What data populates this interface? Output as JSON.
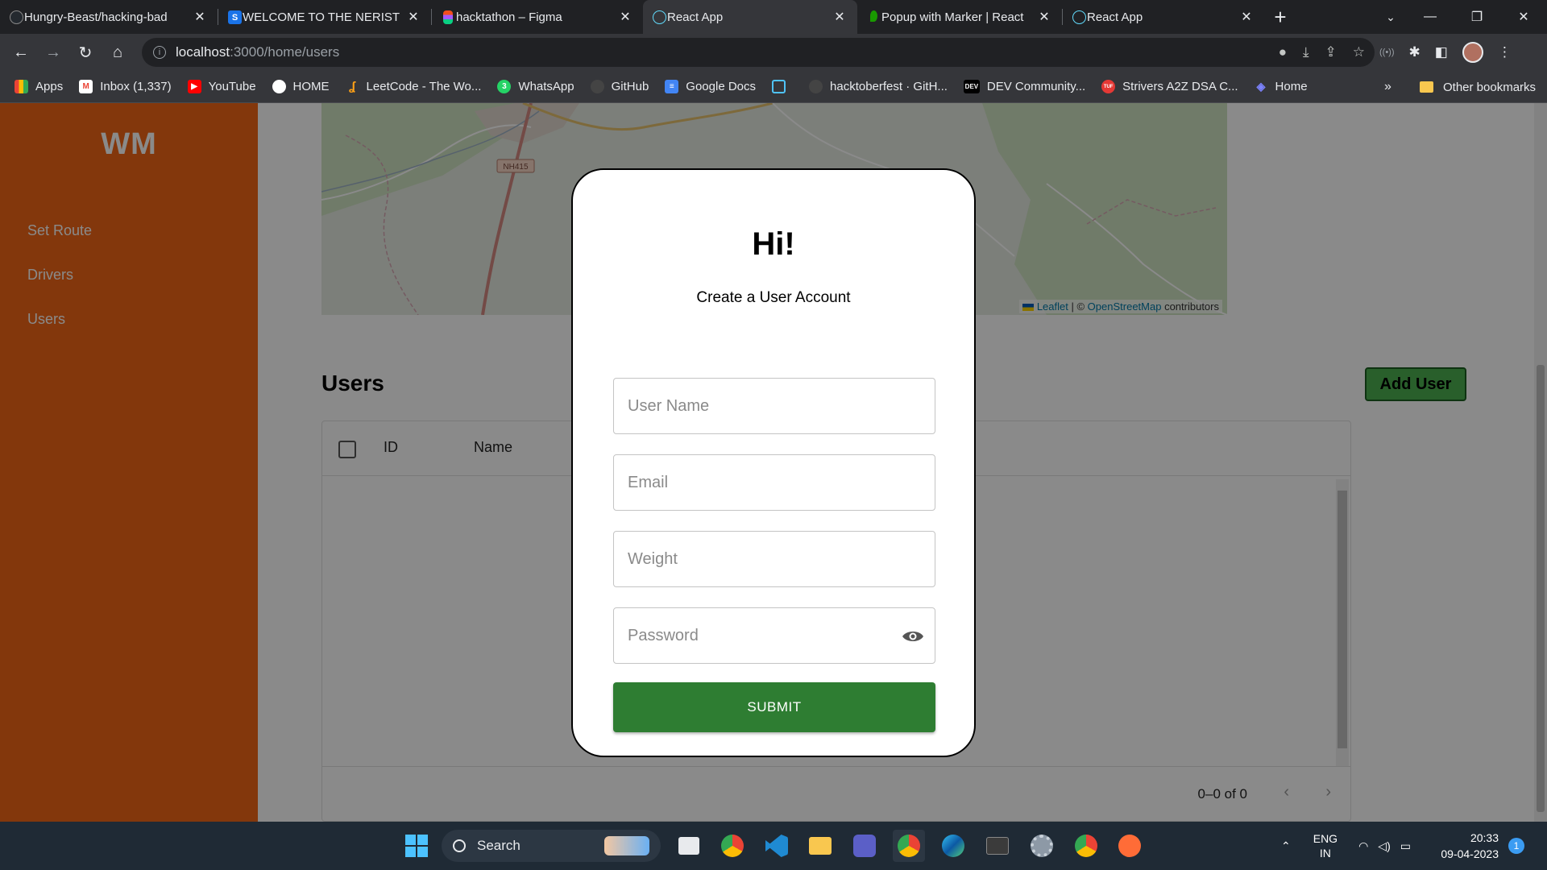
{
  "browser": {
    "tabs": [
      {
        "title": "Hungry-Beast/hacking-bad",
        "icon": "github-icon",
        "color": "#24292f"
      },
      {
        "title": "WELCOME TO THE NERIST",
        "icon": "s-logo-icon",
        "color": "#1a73e8"
      },
      {
        "title": "hacktathon – Figma",
        "icon": "figma-icon",
        "color": "#f24e1e"
      },
      {
        "title": "React App",
        "icon": "react-icon",
        "color": "#61dafb"
      },
      {
        "title": "Popup with Marker | React",
        "icon": "leaf-icon",
        "color": "#199900"
      },
      {
        "title": "React App",
        "icon": "react-icon",
        "color": "#61dafb"
      }
    ],
    "active_tab": 3,
    "url_host": "localhost",
    "url_path": ":3000/home/users",
    "bookmarks": [
      {
        "label": "Apps",
        "icon": "apps-grid-icon",
        "color": "#4285f4"
      },
      {
        "label": "Inbox (1,337)",
        "icon": "gmail-icon",
        "color": "#ea4335"
      },
      {
        "label": "YouTube",
        "icon": "youtube-icon",
        "color": "#ff0000"
      },
      {
        "label": "HOME",
        "icon": "home-circle-icon",
        "color": "#ffffff"
      },
      {
        "label": "LeetCode - The Wo...",
        "icon": "leetcode-icon",
        "color": "#ffa116"
      },
      {
        "label": "WhatsApp",
        "icon": "whatsapp-icon",
        "color": "#25d366"
      },
      {
        "label": "GitHub",
        "icon": "github-icon",
        "color": "#444444"
      },
      {
        "label": "Google Docs",
        "icon": "docs-icon",
        "color": "#4285f4"
      },
      {
        "label": "",
        "icon": "bracket-icon",
        "color": "#4fc3f7"
      },
      {
        "label": "hacktoberfest · GitH...",
        "icon": "github-icon",
        "color": "#444444"
      },
      {
        "label": "DEV Community...",
        "icon": "dev-icon",
        "color": "#000000"
      },
      {
        "label": "Strivers A2Z DSA C...",
        "icon": "tuf-icon",
        "color": "#e53935"
      },
      {
        "label": "Home",
        "icon": "home-wave-icon",
        "color": "#7c83fd"
      }
    ],
    "more_label": "»",
    "other_bookmarks": "Other bookmarks"
  },
  "app": {
    "logo": "WM",
    "nav": [
      {
        "label": "Set Route"
      },
      {
        "label": "Drivers"
      },
      {
        "label": "Users"
      }
    ],
    "map": {
      "road_label": "NH415",
      "attribution_leaflet": "Leaflet",
      "attribution_sep": " | © ",
      "attribution_osm": "OpenStreetMap",
      "attribution_tail": " contributors"
    },
    "users_title": "Users",
    "add_user_label": "Add User",
    "grid": {
      "columns": [
        "ID",
        "Name"
      ],
      "rows": [],
      "pagination": "0–0 of 0"
    }
  },
  "modal": {
    "title": "Hi!",
    "subtitle": "Create a User Account",
    "fields": {
      "username_placeholder": "User Name",
      "email_placeholder": "Email",
      "weight_placeholder": "Weight",
      "password_placeholder": "Password"
    },
    "submit_label": "SUBMIT"
  },
  "taskbar": {
    "search_label": "Search",
    "lang_line1": "ENG",
    "lang_line2": "IN",
    "time": "20:33",
    "date": "09-04-2023",
    "notification_count": "1"
  },
  "colors": {
    "sidebar": "#f26617",
    "submit": "#2e7d32",
    "add_user": "#4caf50",
    "overlay": "rgba(0,0,0,0.46)"
  }
}
